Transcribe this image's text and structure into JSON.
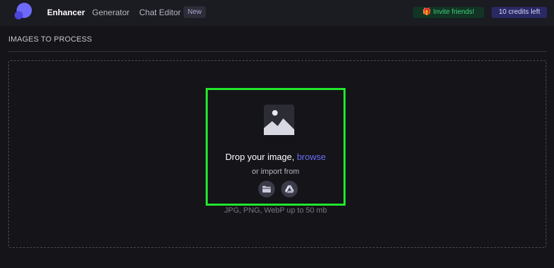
{
  "navbar": {
    "logo_icon": "app-logo-icon",
    "links": [
      {
        "label": "Enhancer",
        "active": true
      },
      {
        "label": "Generator",
        "active": false
      },
      {
        "label": "Chat Editor",
        "active": false
      }
    ],
    "new_badge": "New",
    "invite_label": "Invite friends!",
    "invite_icon": "gift-icon",
    "credits_label": "10 credits left"
  },
  "section": {
    "title": "IMAGES TO PROCESS"
  },
  "dropzone": {
    "icon": "image-icon",
    "drop_text": "Drop your image, ",
    "browse_label": "browse",
    "import_text": "or import from",
    "import_sources": [
      {
        "icon": "folder-icon"
      },
      {
        "icon": "google-drive-icon"
      }
    ],
    "formats_text": "JPG, PNG, WebP up to 50 mb"
  },
  "colors": {
    "background": "#141419",
    "navbar": "#1b1b22",
    "accent": "#6c6cf6",
    "highlight_border": "#22e82a",
    "invite_green": "#3ed17c",
    "credits_bg": "#2a2963"
  }
}
